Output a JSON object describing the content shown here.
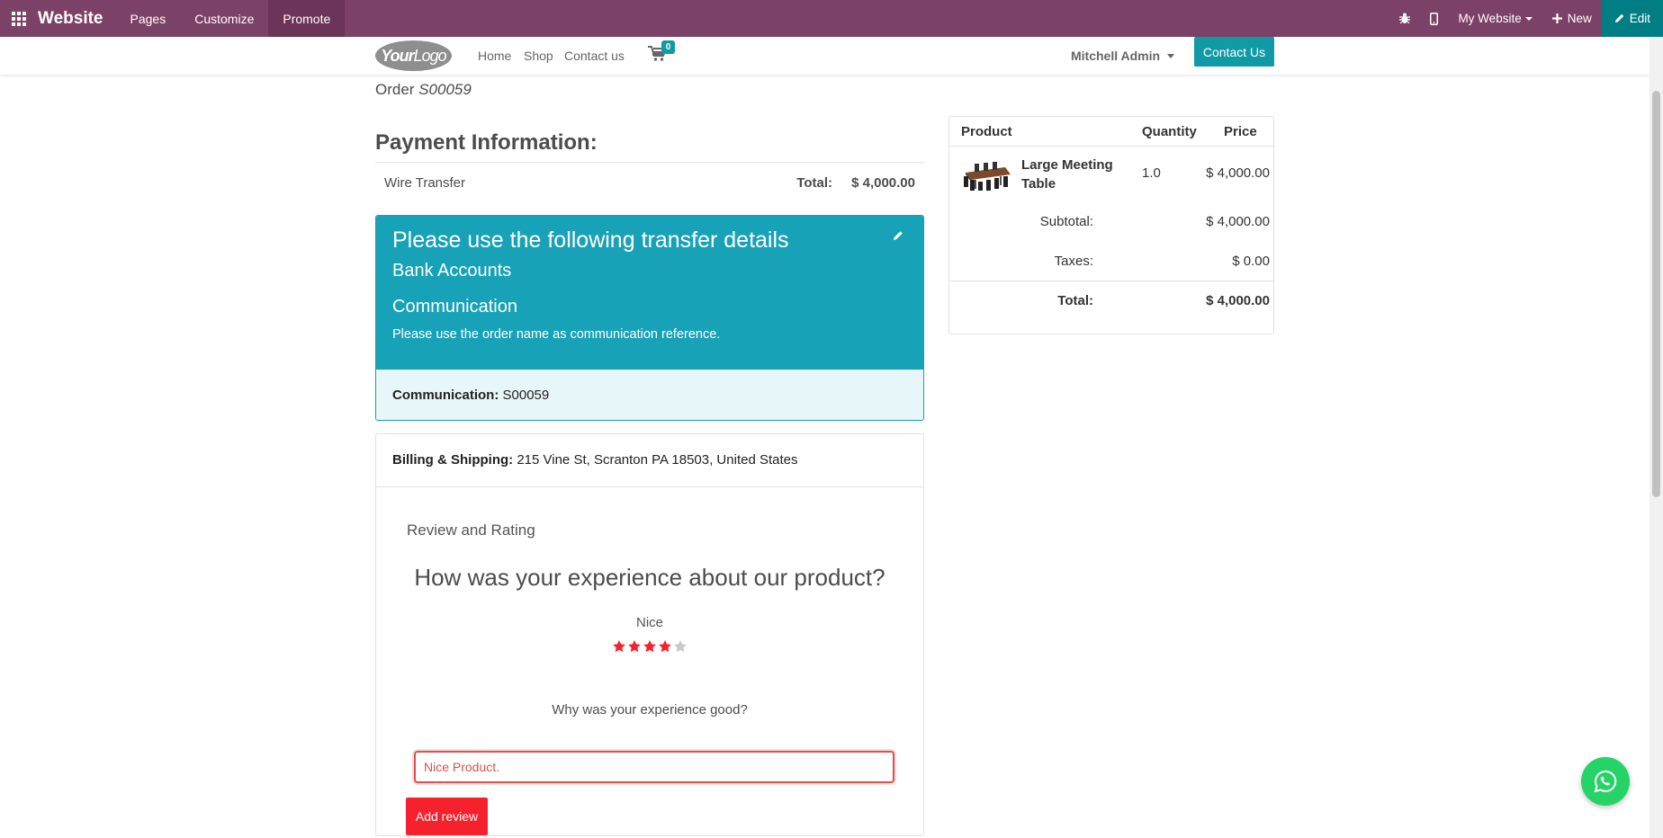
{
  "admin_bar": {
    "brand": "Website",
    "menus": [
      "Pages",
      "Customize",
      "Promote"
    ],
    "my_website": "My Website",
    "new_label": "New",
    "edit_label": "Edit"
  },
  "site_header": {
    "logo_bold": "Your",
    "logo_light": "Logo",
    "nav": [
      "Home",
      "Shop",
      "Contact us"
    ],
    "cart_count": "0",
    "user": "Mitchell Admin",
    "contact_button": "Contact Us"
  },
  "order": {
    "prefix": "Order",
    "number": "S00059"
  },
  "payment": {
    "title": "Payment Information:",
    "method": "Wire Transfer",
    "total_label": "Total:",
    "total_value": "$ 4,000.00"
  },
  "transfer": {
    "title": "Please use the following transfer details",
    "bank_accounts": "Bank Accounts",
    "communication_heading": "Communication",
    "note": "Please use the order name as communication reference.",
    "communication_label": "Communication:",
    "communication_value": "S00059"
  },
  "billing": {
    "label": "Billing & Shipping:",
    "address": "215 Vine St, Scranton PA 18503, United States"
  },
  "review": {
    "section_label": "Review and Rating",
    "question": "How was your experience about our product?",
    "rating_text": "Nice",
    "rating": 4,
    "rating_max": 5,
    "follow_up": "Why was your experience good?",
    "input_value": "Nice Product.",
    "submit_label": "Add review"
  },
  "summary": {
    "headers": {
      "product": "Product",
      "quantity": "Quantity",
      "price": "Price"
    },
    "line": {
      "name": "Large Meeting Table",
      "quantity": "1.0",
      "price": "$ 4,000.00"
    },
    "subtotal_label": "Subtotal:",
    "subtotal_value": "$ 4,000.00",
    "taxes_label": "Taxes:",
    "taxes_value": "$ 0.00",
    "total_label": "Total:",
    "total_value": "$ 4,000.00"
  },
  "colors": {
    "admin_bar": "#7c4166",
    "accent": "#0f9aa5",
    "transfer_bg": "#17a2b8",
    "star_on": "#f5222d",
    "star_off": "#c8c8c8",
    "whatsapp": "#25d366"
  },
  "icons": [
    "apps-grid-icon",
    "bug-icon",
    "mobile-icon",
    "plus-icon",
    "pencil-icon",
    "cart-icon",
    "star-icon",
    "whatsapp-icon"
  ]
}
